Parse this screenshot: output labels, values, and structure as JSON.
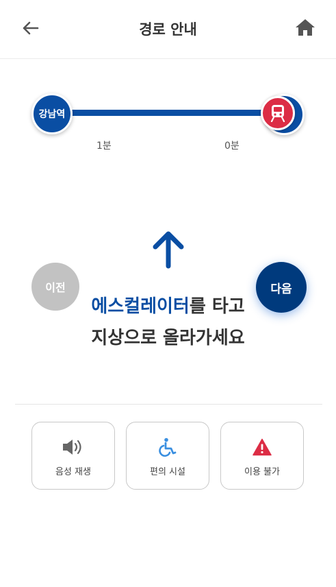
{
  "header": {
    "title": "경로 안내",
    "back_icon": "arrow-left-icon",
    "home_icon": "home-icon"
  },
  "route": {
    "start_station": "강남역",
    "end_station_icon": "subway-icon",
    "train_icon": "train-icon",
    "times": [
      "1분",
      "0분"
    ],
    "line_color": "#0a4ea3",
    "train_color": "#dc2d45"
  },
  "direction": {
    "arrow_icon": "arrow-up-icon",
    "prev_label": "이전",
    "next_label": "다음",
    "instruction_highlight": "에스컬레이터",
    "instruction_line1_rest": "를 타고",
    "instruction_line2": "지상으로 올라가세요"
  },
  "actions": [
    {
      "label": "음성 재생",
      "icon": "speaker-icon",
      "color": "#666666"
    },
    {
      "label": "편의 시설",
      "icon": "wheelchair-icon",
      "color": "#3a8fe0"
    },
    {
      "label": "이용 불가",
      "icon": "warning-icon",
      "color": "#dc2d45"
    }
  ]
}
